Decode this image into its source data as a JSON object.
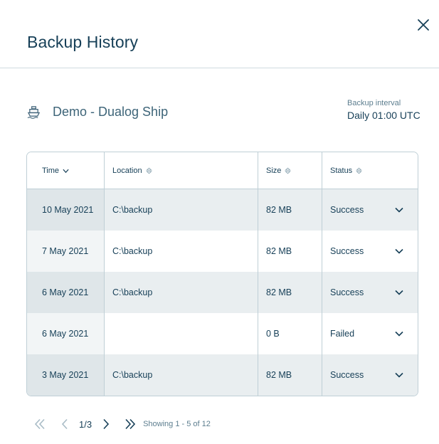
{
  "dialog": {
    "title": "Backup History"
  },
  "ship": {
    "name": "Demo - Dualog Ship",
    "icon": "ship-icon"
  },
  "interval": {
    "label": "Backup interval",
    "value": "Daily 01:00 UTC"
  },
  "table": {
    "headers": [
      "Time",
      "Location",
      "Size",
      "Status"
    ],
    "sort": {
      "column": "Time",
      "direction": "descending"
    },
    "rows": [
      {
        "time": "10 May 2021",
        "location": "C:\\backup",
        "size": "82 MB",
        "status": "Success"
      },
      {
        "time": "7 May 2021",
        "location": "C:\\backup",
        "size": "82 MB",
        "status": "Success"
      },
      {
        "time": "6 May 2021",
        "location": "C:\\backup",
        "size": "82 MB",
        "status": "Success"
      },
      {
        "time": "6 May 2021",
        "location": "",
        "size": "0 B",
        "status": "Failed"
      },
      {
        "time": "3 May 2021",
        "location": "C:\\backup",
        "size": "82 MB",
        "status": "Success"
      }
    ]
  },
  "pagination": {
    "page": "1/3",
    "info": "Showing 1 - 5 of 12"
  },
  "colors": {
    "text": "#163f57",
    "accent": "#4a6b80",
    "border": "#bfcfd6",
    "row_shade": "#e9eef0"
  }
}
